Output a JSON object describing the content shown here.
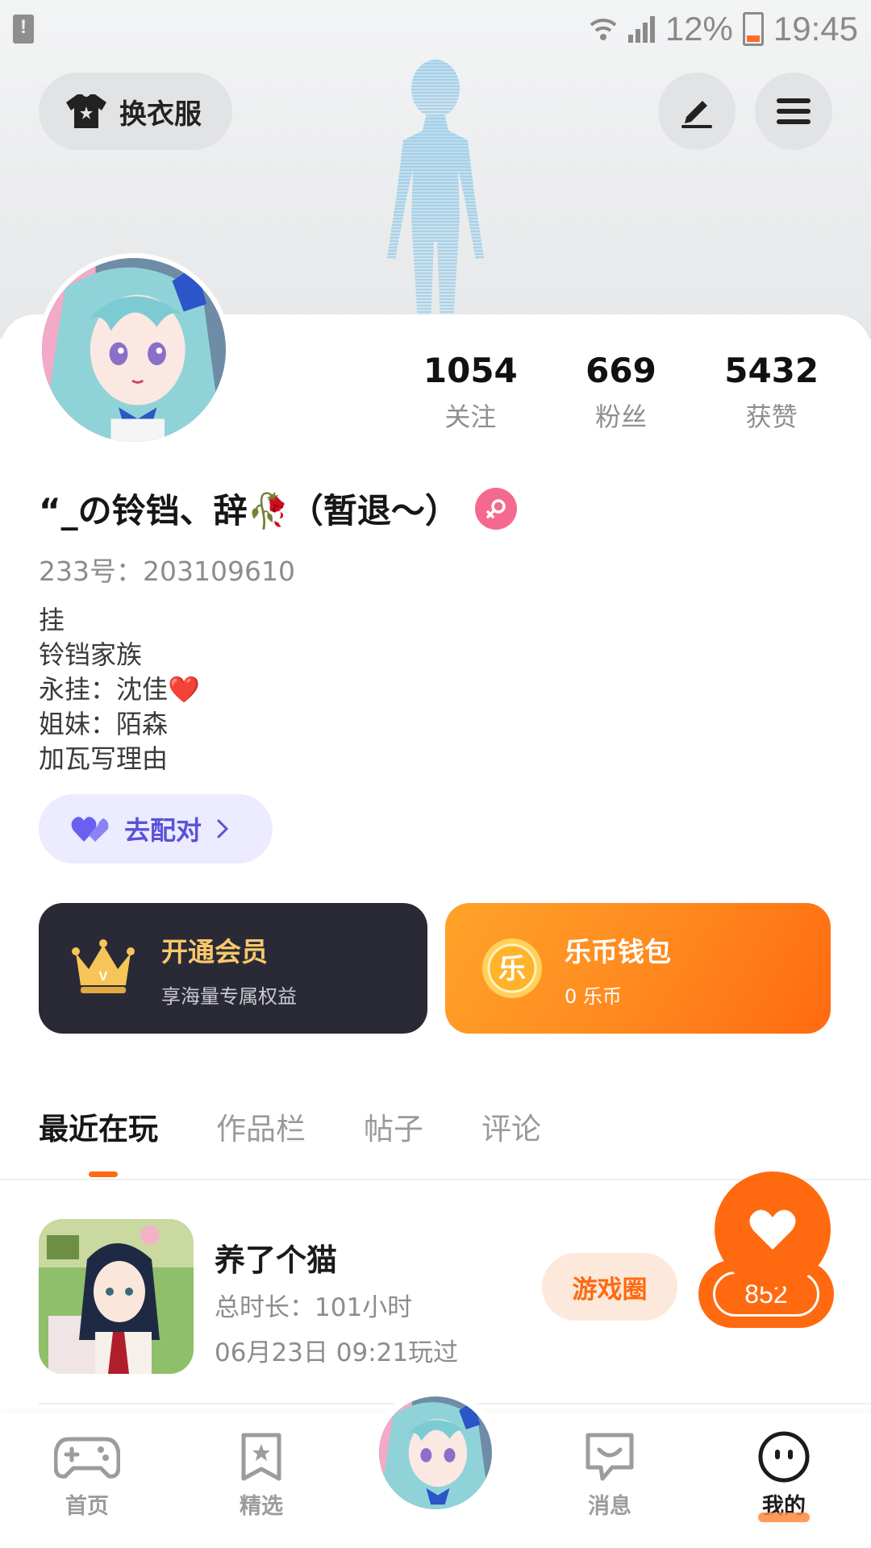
{
  "status_bar": {
    "battery": "12%",
    "time": "19:45"
  },
  "header": {
    "skin_button_label": "换衣服",
    "edit_icon": "pencil-icon",
    "menu_icon": "hamburger-menu-icon"
  },
  "profile": {
    "stats": [
      {
        "value": "1054",
        "label": "关注"
      },
      {
        "value": "669",
        "label": "粉丝"
      },
      {
        "value": "5432",
        "label": "获赞"
      }
    ],
    "nickname": "“_の铃铛、辞🥀（暂退～）",
    "gender": "female",
    "uid": "233号：203109610",
    "bio": [
      "挂",
      "铃铛家族",
      "永挂：沈佳❤️",
      "姐妹：陌森",
      "加瓦写理由"
    ],
    "match_button": "去配对"
  },
  "cards": {
    "vip": {
      "title": "开通会员",
      "subtitle": "享海量专属权益"
    },
    "wallet": {
      "title": "乐币钱包",
      "subtitle": "0 乐币",
      "coin_char": "乐"
    }
  },
  "tabs": [
    {
      "label": "最近在玩",
      "active": true
    },
    {
      "label": "作品栏",
      "active": false
    },
    {
      "label": "帖子",
      "active": false
    },
    {
      "label": "评论",
      "active": false
    }
  ],
  "recent_game": {
    "name": "养了个猫",
    "total_time": "总时长：101小时",
    "last_played": "06月23日 09:21玩过",
    "circle_button": "游戏圈"
  },
  "like_fab": {
    "count": "852"
  },
  "bottom_nav": [
    {
      "label": "首页",
      "icon": "gamepad-icon",
      "active": false
    },
    {
      "label": "精选",
      "icon": "star-bookmark-icon",
      "active": false
    },
    {
      "label": "消息",
      "icon": "chat-bubble-icon",
      "active": false
    },
    {
      "label": "我的",
      "icon": "smiley-face-icon",
      "active": true
    }
  ],
  "colors": {
    "accent": "#ff6a10",
    "vip_gold": "#f7c96a",
    "match_purple": "#5a52d6",
    "gender_pink": "#f46a8e"
  }
}
